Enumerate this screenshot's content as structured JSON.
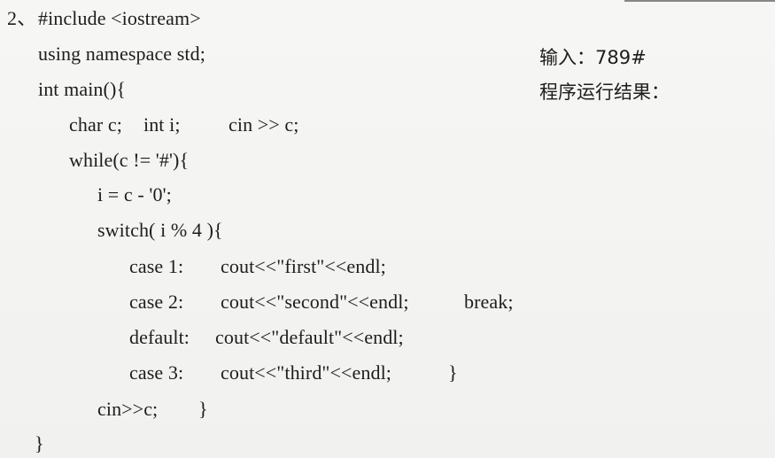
{
  "problem": {
    "number_label": "2、",
    "lines": {
      "include": "#include <iostream>",
      "namespace": "using namespace std;",
      "main": "int main(){",
      "decl_char": "char c;",
      "decl_int": "int i;",
      "cin_first": "cin >> c;",
      "while": "while(c != '#'){",
      "assign": "i = c - '0';",
      "switch": "switch( i % 4 ){",
      "case1_label": "case 1:",
      "case1_stmt": "cout<<\"first\"<<endl;",
      "case2_label": "case 2:",
      "case2_stmt": "cout<<\"second\"<<endl;",
      "case2_break": "break;",
      "default_label": "default:",
      "default_stmt": "cout<<\"default\"<<endl;",
      "case3_label": "case 3:",
      "case3_stmt": "cout<<\"third\"<<endl;",
      "switch_close": "}",
      "cin_loop": "cin>>c;",
      "while_close": "}",
      "main_close": "}"
    }
  },
  "side_notes": {
    "input_label": "输入：789#",
    "output_label": "程序运行结果："
  }
}
